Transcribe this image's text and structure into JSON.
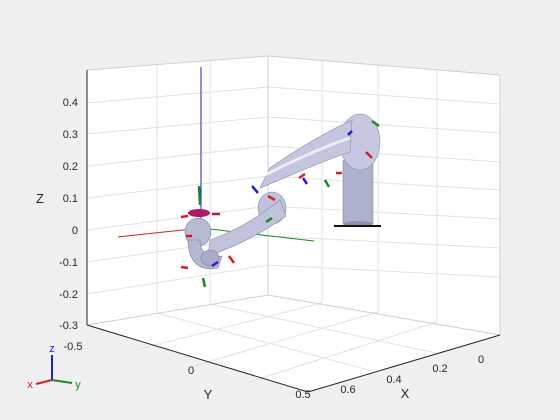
{
  "figure": {
    "background": "#f0f0f0",
    "axes": {
      "xlabel": "X",
      "ylabel": "Y",
      "zlabel": "Z",
      "x_ticks": [
        "0",
        "0.2",
        "0.4",
        "0.6"
      ],
      "y_ticks": [
        "-0.5",
        "0",
        "0.5"
      ],
      "z_ticks": [
        "0.4",
        "0.3",
        "0.2",
        "0.1",
        "0",
        "-0.1",
        "-0.2",
        "-0.3"
      ],
      "grid": true,
      "box": true
    },
    "triad": {
      "x": "x",
      "y": "y",
      "z": "z"
    },
    "colors": {
      "x_axis": "#d42020",
      "y_axis": "#1a8a1a",
      "z_axis": "#1f1fd6",
      "robot_body": "#b9bcd8",
      "robot_shadow": "#6f7290",
      "joint_marker": "#b0186e"
    }
  }
}
